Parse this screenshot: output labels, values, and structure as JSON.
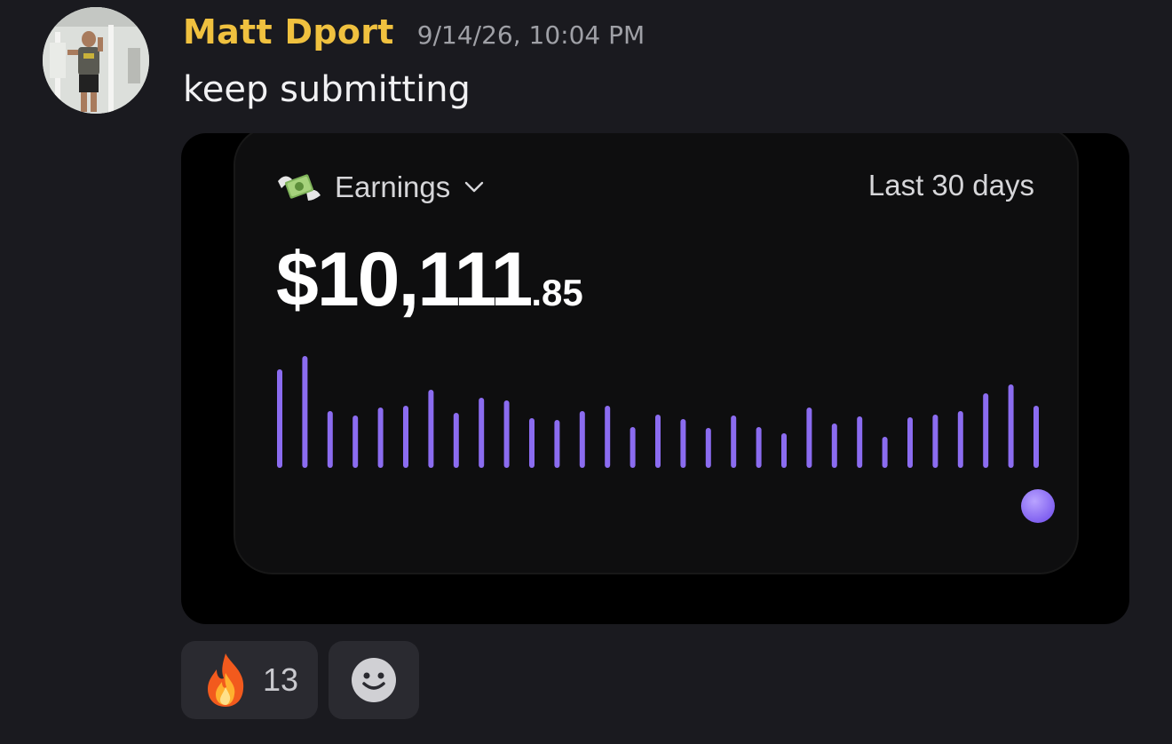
{
  "message": {
    "author": "Matt Dport",
    "timestamp": "9/14/26, 10:04 PM",
    "text": "keep submitting",
    "author_color": "#f0c13f"
  },
  "card": {
    "icon": "money-with-wings-icon",
    "title": "Earnings",
    "period": "Last 30 days",
    "amount_main": "$10,111",
    "amount_cents": ".85",
    "accent_color": "#8b6cf0",
    "chart_data": {
      "type": "bar",
      "values": [
        105,
        120,
        58,
        53,
        62,
        64,
        82,
        56,
        73,
        70,
        50,
        48,
        58,
        64,
        40,
        54,
        49,
        39,
        53,
        40,
        33,
        62,
        44,
        52,
        29,
        51,
        54,
        58,
        78,
        88,
        64
      ],
      "ylim": [
        0,
        130
      ]
    }
  },
  "reactions": [
    {
      "icon": "fire-icon",
      "count": "13"
    }
  ],
  "add_reaction_icon": "add-reaction-smiley-icon"
}
